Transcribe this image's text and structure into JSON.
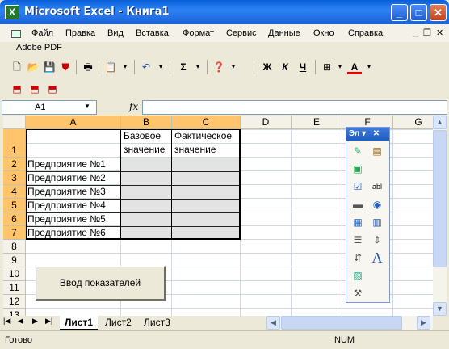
{
  "window": {
    "title": "Microsoft Excel - Книга1",
    "app_icon": "excel-icon",
    "buttons": [
      "minimize",
      "maximize",
      "close"
    ]
  },
  "menu": {
    "items": [
      "Файл",
      "Правка",
      "Вид",
      "Вставка",
      "Формат",
      "Сервис",
      "Данные",
      "Окно",
      "Справка"
    ],
    "adobe": "Adobe PDF"
  },
  "toolbar": {
    "font_buttons": [
      "Ж",
      "К",
      "Ч"
    ],
    "sigma": "Σ",
    "font_color": "A"
  },
  "formula": {
    "namebox": "A1",
    "fx": "fx",
    "value": ""
  },
  "sheet": {
    "columns": [
      "A",
      "B",
      "C",
      "D",
      "E",
      "F",
      "G"
    ],
    "rows": [
      "1",
      "2",
      "3",
      "4",
      "5",
      "6",
      "7",
      "8",
      "9",
      "10",
      "11",
      "12",
      "13"
    ],
    "header_b": [
      "Базовое",
      "значение"
    ],
    "header_c": [
      "Фактическое",
      "значение"
    ],
    "companies": [
      "Предприятие №1",
      "Предприятие №2",
      "Предприятие №3",
      "Предприятие №4",
      "Предприятие №5",
      "Предприятие №6"
    ]
  },
  "macro_button": "Ввод показателей",
  "forms_panel": {
    "title": "Эл",
    "icons": [
      "label-icon",
      "edit-box-icon",
      "group-box-icon",
      "checkbox-icon",
      "option-button-icon",
      "list-box-icon",
      "combo-box-icon",
      "scrollbar-icon",
      "spinner-icon",
      "button-icon",
      "textbox-a-icon",
      "image-icon",
      "properties-icon"
    ]
  },
  "tabs": [
    "Лист1",
    "Лист2",
    "Лист3"
  ],
  "status": {
    "left": "Готово",
    "num": "NUM"
  }
}
